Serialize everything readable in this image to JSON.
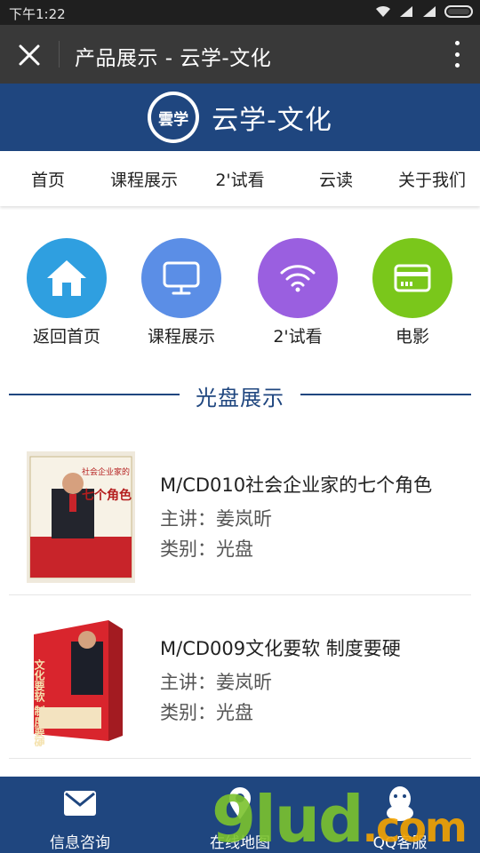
{
  "status_bar": {
    "time": "下午1:22"
  },
  "title_bar": {
    "title": "产品展示 - 云学-文化"
  },
  "brand": {
    "logo_text": "雲学",
    "name": "云学-文化",
    "color": "#1f467f"
  },
  "nav": [
    {
      "label": "首页"
    },
    {
      "label": "课程展示"
    },
    {
      "label": "2'试看"
    },
    {
      "label": "云读"
    },
    {
      "label": "关于我们"
    }
  ],
  "quick_icons": [
    {
      "label": "返回首页",
      "icon": "home-icon",
      "color": "#2f9fe0"
    },
    {
      "label": "课程展示",
      "icon": "monitor-icon",
      "color": "#5b8ee6"
    },
    {
      "label": "2'试看",
      "icon": "wifi-icon",
      "color": "#9a5fe0"
    },
    {
      "label": "电影",
      "icon": "card-icon",
      "color": "#7ac71b"
    }
  ],
  "section": {
    "title": "光盘展示"
  },
  "products": [
    {
      "name": "M/CD010社会企业家的七个角色",
      "speaker": "主讲：姜岚昕",
      "category": "类别：光盘",
      "cover_title": "七个角色",
      "cover_top": "社会企业家的"
    },
    {
      "name": "M/CD009文化要软 制度要硬",
      "speaker": "主讲：姜岚昕",
      "category": "类别：光盘",
      "cover_title": "文化要软 制度要硬",
      "cover_top": ""
    }
  ],
  "bottom_bar": [
    {
      "label": "信息咨询",
      "icon": "mail-icon"
    },
    {
      "label": "在线地图",
      "icon": "map-pin-icon"
    },
    {
      "label": "QQ客服",
      "icon": "qq-penguin-icon"
    }
  ],
  "watermark": {
    "text": "9lud",
    "suffix": ".com"
  }
}
